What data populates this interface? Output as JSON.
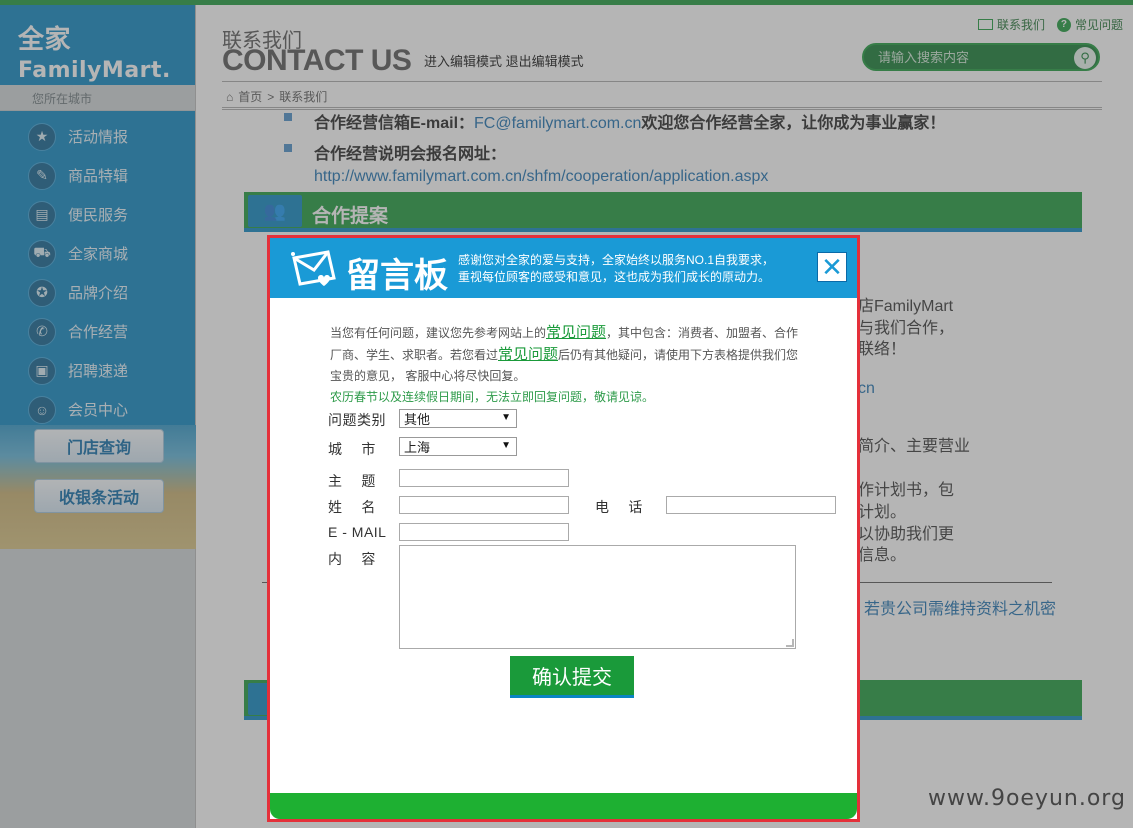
{
  "sidebar": {
    "brand_cn": "全家",
    "brand_en": "FamilyMart.",
    "city_label": "您所在城市",
    "items": [
      {
        "label": "活动情报",
        "icon": "★"
      },
      {
        "label": "商品特辑",
        "icon": "✎"
      },
      {
        "label": "便民服务",
        "icon": "▤"
      },
      {
        "label": "全家商城",
        "icon": "⛟"
      },
      {
        "label": "品牌介绍",
        "icon": "✪"
      },
      {
        "label": "合作经营",
        "icon": "✆"
      },
      {
        "label": "招聘速递",
        "icon": "▣"
      },
      {
        "label": "会员中心",
        "icon": "☺"
      }
    ],
    "store_search": "门店查询",
    "receipt_event": "收银条活动"
  },
  "header": {
    "title_cn": "联系我们",
    "title_en": "CONTACT US",
    "enter_edit": "进入编辑模式",
    "exit_edit": "退出编辑模式",
    "contact_link": "联系我们",
    "faq_link": "常见问题",
    "search_placeholder": "请输入搜索内容",
    "breadcrumb_home": "首页",
    "breadcrumb_sep": ">",
    "breadcrumb_current": "联系我们"
  },
  "content": {
    "email_label": "合作经营信箱E-mail：",
    "email": "FC@familymart.com.cn",
    "email_tail": "欢迎您合作经营全家，让你成为事业赢家！",
    "signup_label": "合作经营说明会报名网址：",
    "signup_url": "http://www.familymart.com.cn/shfm/cooperation/application.aspx",
    "section_title": "合作提案",
    "frag1": "店FamilyMart",
    "frag2": "与我们合作，",
    "frag3": "联络！",
    "frag4": "cn",
    "frag5": "简介、主要营业",
    "frag6": "作计划书，包",
    "frag7": "计划。",
    "frag8": "以协助我们更",
    "frag9": "信息。",
    "frag10": "若贵公司需维持资料之机密"
  },
  "modal": {
    "title": "留言板",
    "subtitle_1": "感谢您对全家的爱与支持，全家始终以服务NO.1自我要求，",
    "subtitle_2": "重视每位顾客的感受和意见，这也成为我们成长的原动力。",
    "close": "✕",
    "intro_1": "当您有任何问题，建议您先参考网站上的",
    "intro_faq_1": "常见问题",
    "intro_2": "，其中包含：消费者、加盟者、合作 厂商、学生、求职者。若您看过",
    "intro_faq_2": "常见问题",
    "intro_3": "后仍有其他疑问，请使用下方表格提供我们您 宝贵的意见， 客服中心将尽快回复。",
    "notice": "农历春节以及连续假日期间，无法立即回复问题，敬请见谅。",
    "labels": {
      "category": "问题类别",
      "city": "城　 市",
      "subject": "主　 题",
      "name": "姓　 名",
      "phone": "电　 话",
      "email": "E - MAIL",
      "content": "内　 容"
    },
    "category_value": "其他",
    "city_value": "上海",
    "submit": "确认提交"
  },
  "watermark": "www.9oeyun.org"
}
